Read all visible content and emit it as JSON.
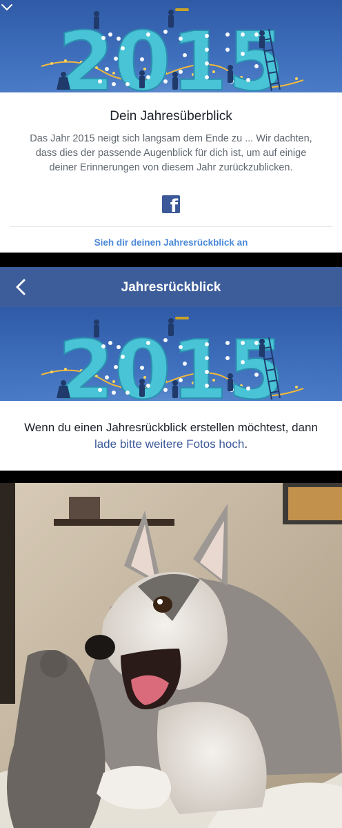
{
  "card": {
    "banner_year": "2015",
    "title": "Dein Jahresüberblick",
    "description": "Das Jahr 2015 neigt sich langsam dem Ende zu ... Wir dachten, dass dies der passende Augenblick für dich ist, um auf einige deiner Erinnerungen von diesem Jahr zurückzublicken.",
    "logo_letter": "f",
    "cta": "Sieh dir deinen Jahresrückblick an"
  },
  "nav": {
    "title": "Jahresrückblick"
  },
  "card2": {
    "banner_year": "2015",
    "message_before": "Wenn du einen Jahresrückblick erstellen möchtest, dann",
    "message_link": "lade bitte weitere Fotos hoch",
    "message_after": "."
  },
  "colors": {
    "banner": "#3d6dba",
    "digits": "#49c3d6",
    "navbar": "#3d5d9a",
    "link": "#4a89d9",
    "facebook": "#3b5998"
  }
}
